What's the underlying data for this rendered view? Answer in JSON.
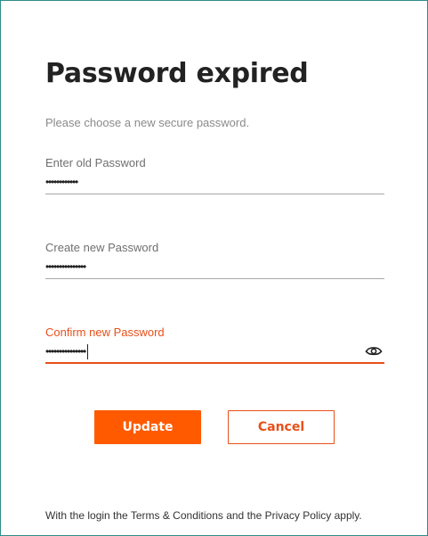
{
  "title": "Password expired",
  "subtitle": "Please choose a new secure password.",
  "fields": [
    {
      "label": "Enter old Password",
      "value": "••••••••••••"
    },
    {
      "label": "Create new Password",
      "value": "•••••••••••••••"
    },
    {
      "label": "Confirm new Password",
      "value": "•••••••••••••••"
    }
  ],
  "icons": {
    "show_password": "eye-icon"
  },
  "buttons": {
    "update": "Update",
    "cancel": "Cancel"
  },
  "footer": "With the login the Terms & Conditions and the Privacy Policy apply.",
  "colors": {
    "accent": "#ff5a00",
    "frame_border": "#2e8b8b",
    "title": "#222222",
    "muted": "#8a8a8a"
  }
}
